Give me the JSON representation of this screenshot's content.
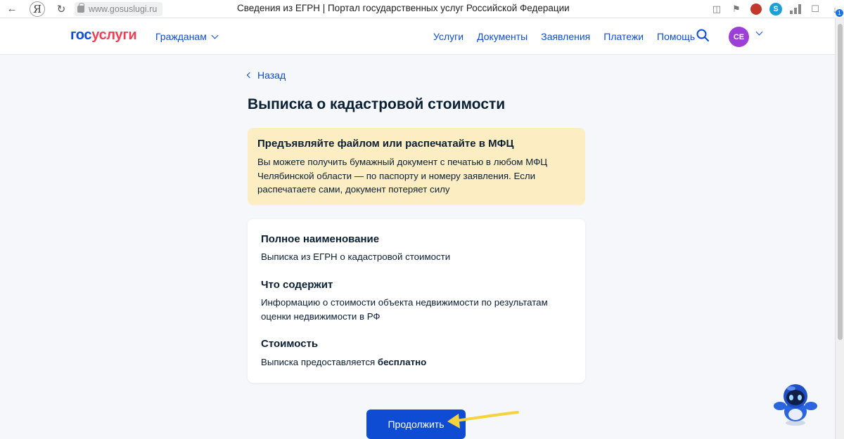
{
  "browser": {
    "url": "www.gosuslugi.ru",
    "tab_title": "Сведения из ЕГРН | Портал государственных услуг Российской Федерации",
    "yandex_letter": "Я",
    "download_badge": "1"
  },
  "header": {
    "logo_part1": "гос",
    "logo_part2": "услуги",
    "citizens_menu": "Гражданам",
    "nav": [
      "Услуги",
      "Документы",
      "Заявления",
      "Платежи",
      "Помощь"
    ],
    "avatar_initials": "СЕ"
  },
  "content": {
    "back_label": "Назад",
    "title": "Выписка о кадастровой стоимости",
    "notice": {
      "title": "Предъявляйте файлом или распечатайте в МФЦ",
      "text": "Вы можете получить бумажный документ с печатью в любом МФЦ Челябинской области — по паспорту и номеру заявления. Если распечатаете сами, документ потеряет силу"
    },
    "info": {
      "full_name_heading": "Полное наименование",
      "full_name_value": "Выписка из ЕГРН о кадастровой стоимости",
      "contains_heading": "Что содержит",
      "contains_value": "Информацию о стоимости объекта недвижимости по результатам оценки недвижимости в РФ",
      "cost_heading": "Стоимость",
      "cost_prefix": "Выписка предоставляется",
      "cost_value": "бесплатно"
    },
    "continue_label": "Продолжить"
  },
  "colors": {
    "brand_blue": "#0d4cd3",
    "brand_red": "#ee3f58",
    "notice_bg": "#fdedc3",
    "avatar_bg": "#9c3fd6",
    "annotation_arrow": "#f5d33a"
  }
}
